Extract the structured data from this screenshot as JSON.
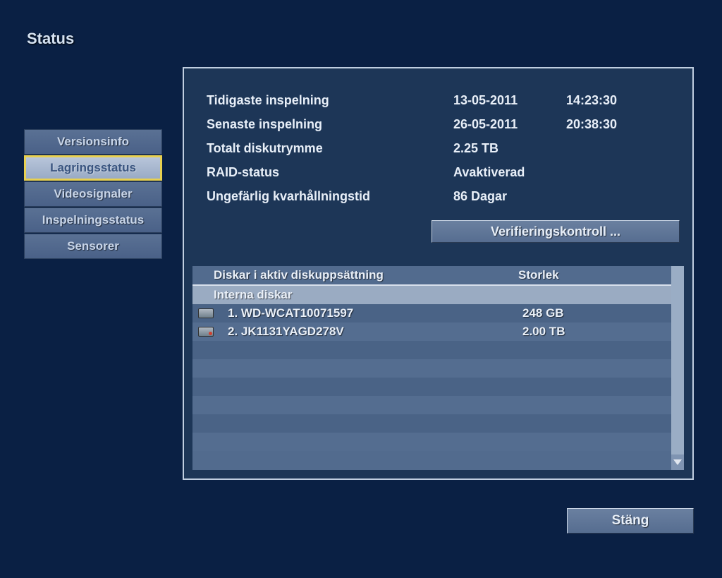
{
  "title": "Status",
  "sidebar": {
    "items": [
      {
        "label": "Versionsinfo",
        "selected": false
      },
      {
        "label": "Lagringsstatus",
        "selected": true
      },
      {
        "label": "Videosignaler",
        "selected": false
      },
      {
        "label": "Inspelningsstatus",
        "selected": false
      },
      {
        "label": "Sensorer",
        "selected": false
      }
    ]
  },
  "info": {
    "earliest_label": "Tidigaste inspelning",
    "earliest_date": "13-05-2011",
    "earliest_time": "14:23:30",
    "latest_label": "Senaste inspelning",
    "latest_date": "26-05-2011",
    "latest_time": "20:38:30",
    "total_label": "Totalt diskutrymme",
    "total_value": "2.25 TB",
    "raid_label": "RAID-status",
    "raid_value": "Avaktiverad",
    "retention_label": "Ungefärlig kvarhållningstid",
    "retention_value": "86  Dagar"
  },
  "verify_button": "Verifieringskontroll ...",
  "disk_table": {
    "col_name": "Diskar i aktiv diskuppsättning",
    "col_size": "Storlek",
    "section": "Interna diskar",
    "rows": [
      {
        "label": "1. WD-WCAT10071597",
        "size": "248 GB",
        "icon_red": false
      },
      {
        "label": "2. JK1131YAGD278V",
        "size": "2.00 TB",
        "icon_red": true
      }
    ]
  },
  "close_button": "Stäng"
}
